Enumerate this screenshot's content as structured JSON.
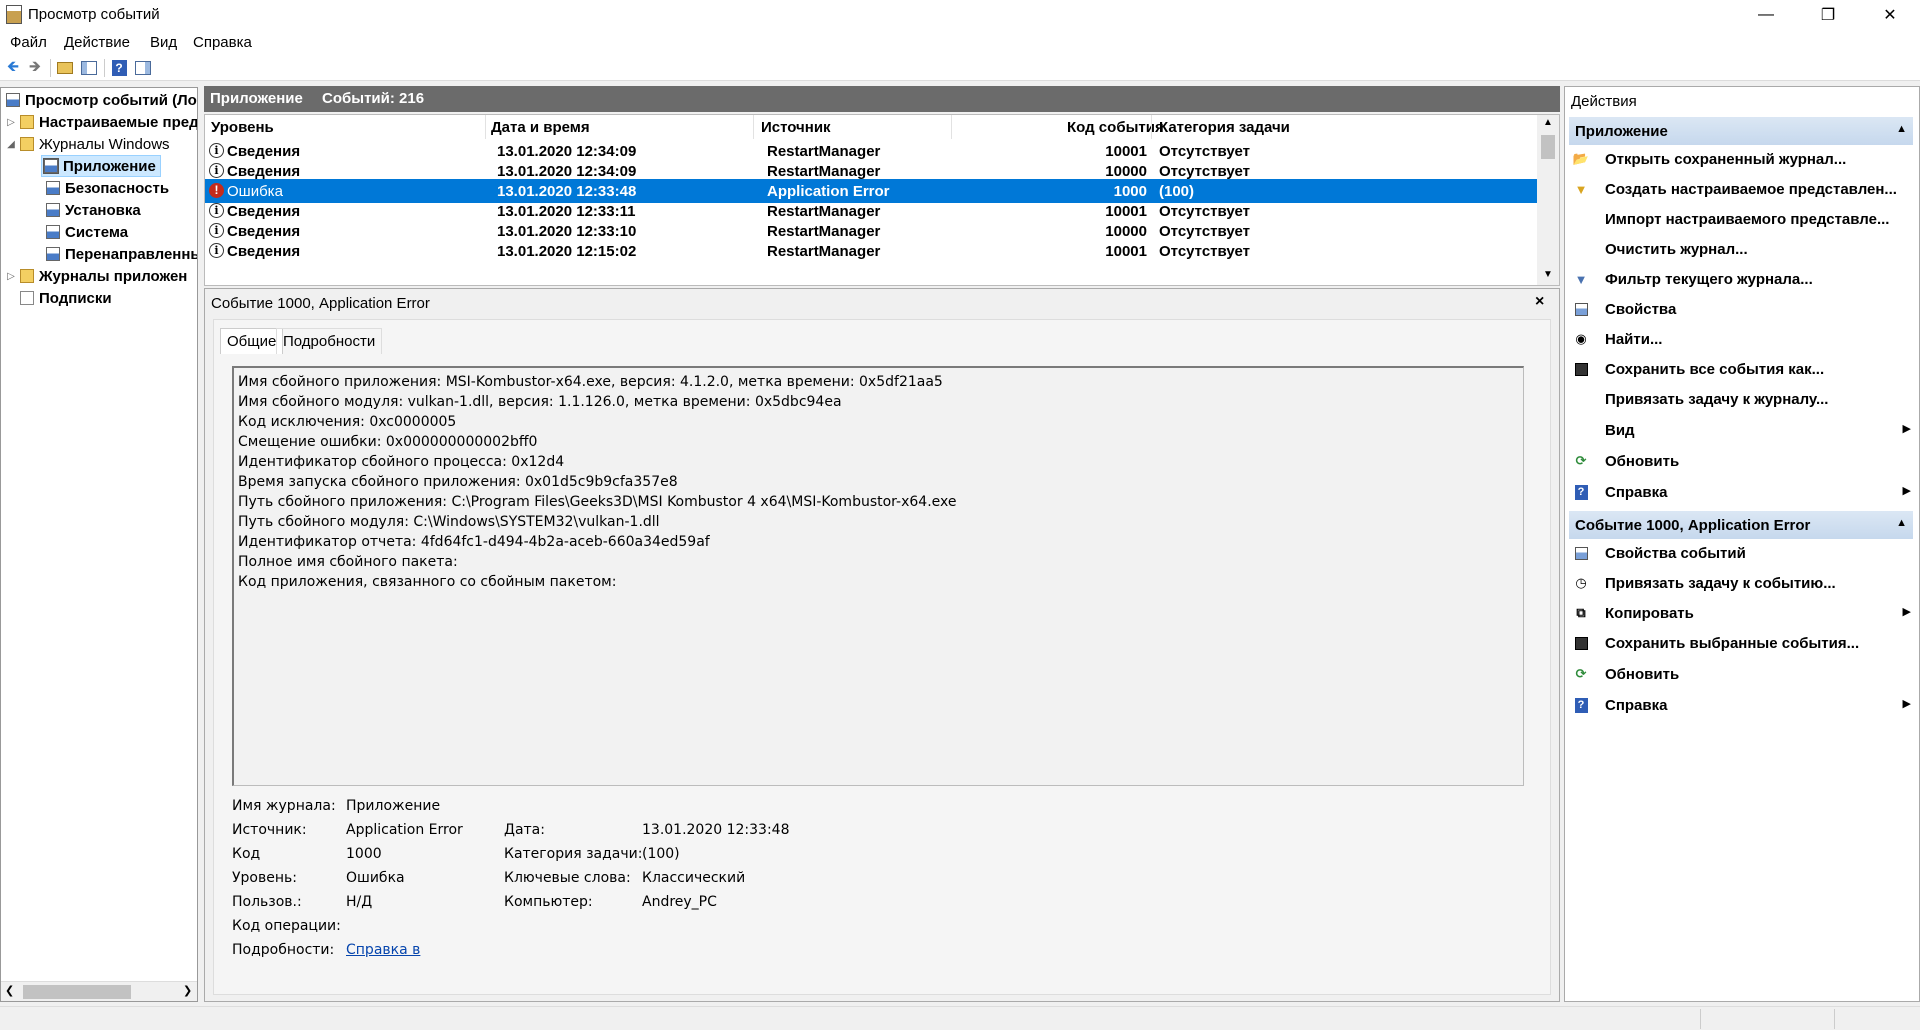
{
  "window": {
    "title": "Просмотр событий"
  },
  "menu": {
    "items": [
      "Файл",
      "Действие",
      "Вид",
      "Справка"
    ]
  },
  "tree": {
    "root": "Просмотр событий (Ло",
    "custom_views": "Настраиваемые пред",
    "windows_logs": "Журналы Windows",
    "application": "Приложение",
    "security": "Безопасность",
    "setup": "Установка",
    "system": "Система",
    "forwarded": "Перенаправленнь",
    "app_logs": "Журналы приложен",
    "subscriptions": "Подписки"
  },
  "list_header": {
    "log_name": "Приложение",
    "count_label": "Событий: 216"
  },
  "grid": {
    "columns": [
      "Уровень",
      "Дата и время",
      "Источник",
      "Код события",
      "Категория задачи"
    ],
    "rows": [
      {
        "level": "Сведения",
        "datetime": "13.01.2020 12:34:09",
        "source": "RestartManager",
        "code": "10001",
        "category": "Отсутствует"
      },
      {
        "level": "Сведения",
        "datetime": "13.01.2020 12:34:09",
        "source": "RestartManager",
        "code": "10000",
        "category": "Отсутствует"
      },
      {
        "level": "Ошибка",
        "datetime": "13.01.2020 12:33:48",
        "source": "Application Error",
        "code": "1000",
        "category": "(100)"
      },
      {
        "level": "Сведения",
        "datetime": "13.01.2020 12:33:11",
        "source": "RestartManager",
        "code": "10001",
        "category": "Отсутствует"
      },
      {
        "level": "Сведения",
        "datetime": "13.01.2020 12:33:10",
        "source": "RestartManager",
        "code": "10000",
        "category": "Отсутствует"
      },
      {
        "level": "Сведения",
        "datetime": "13.01.2020 12:15:02",
        "source": "RestartManager",
        "code": "10001",
        "category": "Отсутствует"
      }
    ],
    "selected_index": 2
  },
  "detail": {
    "title": "Событие 1000, Application Error",
    "close": "×",
    "tabs": [
      "Общие",
      "Подробности"
    ],
    "description": [
      "Имя сбойного приложения: MSI-Kombustor-x64.exe, версия: 4.1.2.0, метка времени: 0x5df21aa5",
      "Имя сбойного модуля: vulkan-1.dll, версия: 1.1.126.0, метка времени: 0x5dbc94ea",
      "Код исключения: 0xc0000005",
      "Смещение ошибки: 0x000000000002bff0",
      "Идентификатор сбойного процесса: 0x12d4",
      "Время запуска сбойного приложения: 0x01d5c9b9cfa357e8",
      "Путь сбойного приложения: C:\\Program Files\\Geeks3D\\MSI Kombustor 4 x64\\MSI-Kombustor-x64.exe",
      "Путь сбойного модуля: C:\\Windows\\SYSTEM32\\vulkan-1.dll",
      "Идентификатор отчета: 4fd64fc1-d494-4b2a-aceb-660a34ed59af",
      "Полное имя сбойного пакета:",
      "Код приложения, связанного со сбойным пакетом:"
    ],
    "props": {
      "log_name_label": "Имя журнала:",
      "log_name": "Приложение",
      "source_label": "Источник:",
      "source": "Application Error",
      "date_label": "Дата:",
      "date": "13.01.2020 12:33:48",
      "code_label": "Код",
      "code": "1000",
      "category_label": "Категория задачи:",
      "category": "(100)",
      "level_label": "Уровень:",
      "level": "Ошибка",
      "keywords_label": "Ключевые слова:",
      "keywords": "Классический",
      "user_label": "Пользов.:",
      "user": "Н/Д",
      "computer_label": "Компьютер:",
      "computer": "Andrey_PC",
      "opcode_label": "Код операции:",
      "details_label": "Подробности:",
      "details_link": "Справка в "
    }
  },
  "actions": {
    "title": "Действия",
    "section1": "Приложение",
    "section1_items": [
      {
        "label": "Открыть сохраненный журнал...",
        "icon": "folder-open-icon",
        "submenu": false
      },
      {
        "label": "Создать настраиваемое представлен...",
        "icon": "filter-create-icon",
        "submenu": false
      },
      {
        "label": "Импорт настраиваемого представле...",
        "icon": "",
        "submenu": false
      },
      {
        "label": "Очистить журнал...",
        "icon": "",
        "submenu": false
      },
      {
        "label": "Фильтр текущего журнала...",
        "icon": "filter-icon",
        "submenu": false
      },
      {
        "label": "Свойства",
        "icon": "properties-icon",
        "submenu": false
      },
      {
        "label": "Найти...",
        "icon": "binoculars-icon",
        "submenu": false
      },
      {
        "label": "Сохранить все события как...",
        "icon": "save-icon",
        "submenu": false
      },
      {
        "label": "Привязать задачу к журналу...",
        "icon": "",
        "submenu": false
      },
      {
        "label": "Вид",
        "icon": "",
        "submenu": true
      },
      {
        "label": "Обновить",
        "icon": "refresh-icon",
        "submenu": false
      },
      {
        "label": "Справка",
        "icon": "help-icon",
        "submenu": true
      }
    ],
    "section2": "Событие 1000, Application Error",
    "section2_items": [
      {
        "label": "Свойства событий",
        "icon": "event-properties-icon",
        "submenu": false
      },
      {
        "label": "Привязать задачу к событию...",
        "icon": "task-icon",
        "submenu": false
      },
      {
        "label": "Копировать",
        "icon": "copy-icon",
        "submenu": true
      },
      {
        "label": "Сохранить выбранные события...",
        "icon": "save-icon",
        "submenu": false
      },
      {
        "label": "Обновить",
        "icon": "refresh-icon",
        "submenu": false
      },
      {
        "label": "Справка",
        "icon": "help-icon",
        "submenu": true
      }
    ]
  }
}
